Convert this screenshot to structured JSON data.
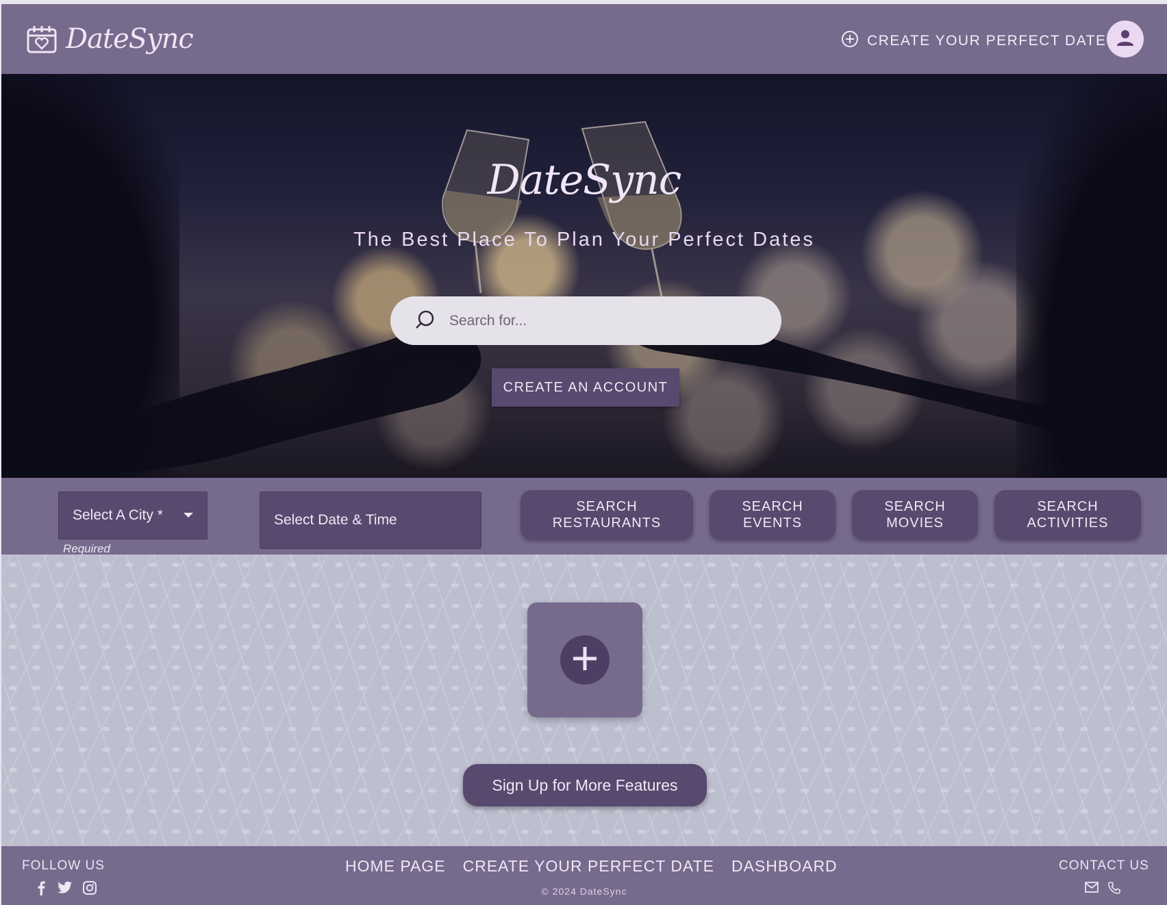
{
  "header": {
    "brand_name": "DateSync",
    "create_date_link": "CREATE YOUR PERFECT DATE"
  },
  "hero": {
    "title": "DateSync",
    "subtitle": "The Best Place To Plan Your Perfect Dates",
    "search_placeholder": "Search for...",
    "create_account_button": "CREATE AN ACCOUNT"
  },
  "filters": {
    "city_select_label": "Select A City *",
    "city_helper_text": "Required",
    "datetime_placeholder": "Select Date & Time",
    "buttons": [
      {
        "label": "SEARCH\nRESTAURANTS"
      },
      {
        "label": "SEARCH\nEVENTS"
      },
      {
        "label": "SEARCH\nMOVIES"
      },
      {
        "label": "SEARCH\nACTIVITIES"
      }
    ]
  },
  "main": {
    "signup_button": "Sign Up for More Features"
  },
  "footer": {
    "follow_title": "FOLLOW US",
    "social_icons": [
      "facebook-icon",
      "twitter-icon",
      "instagram-icon"
    ],
    "links": [
      "HOME PAGE",
      "CREATE YOUR PERFECT DATE",
      "DASHBOARD"
    ],
    "copyright": "© 2024 DateSync",
    "contact_title": "CONTACT US",
    "contact_icons": [
      "mail-icon",
      "phone-icon"
    ]
  },
  "colors": {
    "primary": "#766a8d",
    "dark": "#58496f",
    "accent_light": "#ead9f0"
  }
}
